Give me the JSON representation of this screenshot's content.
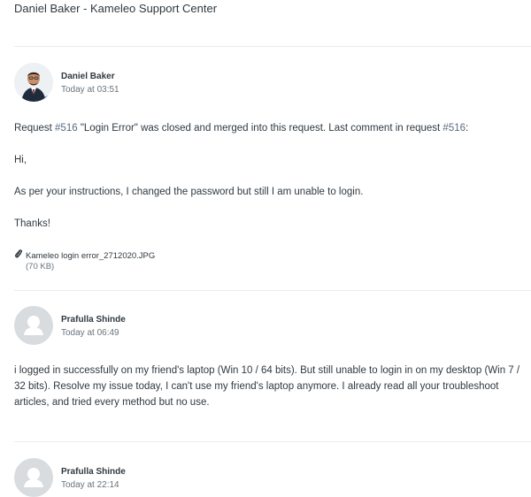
{
  "page": {
    "title": "Daniel Baker - Kameleo Support Center"
  },
  "comments": [
    {
      "author": "Daniel Baker",
      "time": "Today at 03:51",
      "merge_prefix": "Request ",
      "merge_ref1": "#516",
      "merge_mid": " \"Login Error\" was closed and merged into this request. Last comment in request ",
      "merge_ref2": "#516",
      "merge_suffix": ":",
      "body": [
        "Hi,",
        "As per your instructions, I changed the password but still I am unable to login.",
        "Thanks!"
      ],
      "attachment": {
        "name": "Kameleo login error_2712020.JPG",
        "size": "(70 KB)"
      }
    },
    {
      "author": "Prafulla Shinde",
      "time": "Today at 06:49",
      "body": [
        "i logged in successfully on my friend's laptop (Win 10 / 64 bits). But still unable to login in on my desktop (Win 7 / 32 bits). Resolve my issue today, I can't use my friend's laptop anymore. I already read all your troubleshoot articles, and tried every method but no use."
      ]
    },
    {
      "author": "Prafulla Shinde",
      "time": "Today at 22:14"
    }
  ],
  "colors": {
    "text": "#2f3941",
    "muted": "#68737d",
    "divider": "#e9ebed",
    "avatar_bg": "#d8dcde"
  }
}
